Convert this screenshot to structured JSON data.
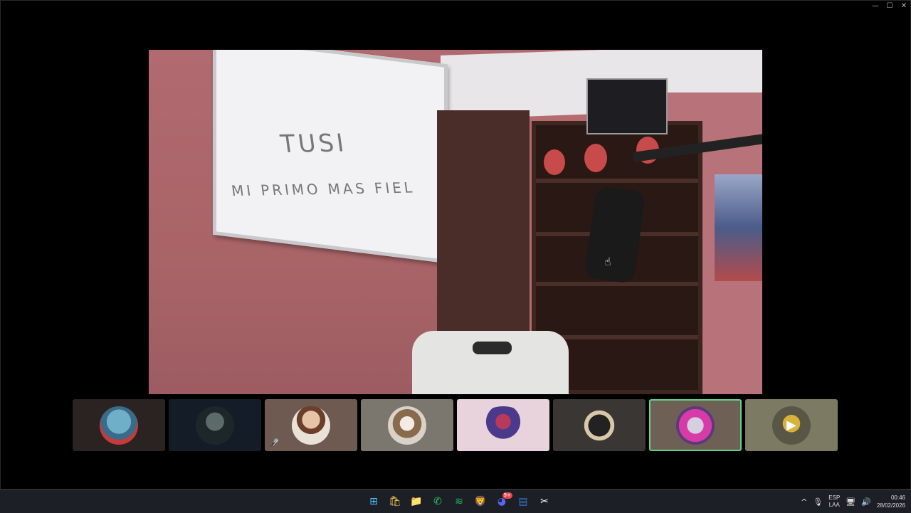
{
  "window": {
    "controls": [
      {
        "name": "minimize",
        "glyph": "—"
      },
      {
        "name": "maximize",
        "glyph": "☐"
      },
      {
        "name": "close",
        "glyph": "✕"
      }
    ]
  },
  "main_video": {
    "whiteboard_text": [
      "TUSI",
      "MI PRIMO MAS FIEL"
    ],
    "cursor": "hand-pointer"
  },
  "participants": [
    {
      "avatar": "anime-character-avatar",
      "bg": "#2b2322",
      "muted": false,
      "active": false
    },
    {
      "avatar": "dark-figure-avatar",
      "bg": "#141c27",
      "muted": false,
      "active": false
    },
    {
      "avatar": "illustrated-man-avatar",
      "bg": "#6e5a50",
      "muted": true,
      "mute_icon": "🎤̸",
      "active": false
    },
    {
      "avatar": "dog-avatar",
      "bg": "#7b776f",
      "muted": false,
      "active": false
    },
    {
      "avatar": "winged-person-avatar",
      "bg": "#e8d2dc",
      "muted": false,
      "active": false
    },
    {
      "avatar": "glowing-orb-avatar",
      "bg": "#3a3634",
      "muted": false,
      "active": false
    },
    {
      "avatar": "pink-collage-avatar",
      "bg": "#6e6055",
      "muted": false,
      "active": true
    },
    {
      "avatar": "camera-avatar",
      "bg": "#7d7a63",
      "muted": false,
      "active": false,
      "camera_glyph": "▶"
    }
  ],
  "taskbar": {
    "apps": [
      {
        "name": "windows-start",
        "glyph": "⊞",
        "color": "#4cc2ff"
      },
      {
        "name": "microsoft-store",
        "glyph": "🛍",
        "color": "#f2c14e"
      },
      {
        "name": "file-explorer",
        "glyph": "📁",
        "color": "#f5c242"
      },
      {
        "name": "whatsapp",
        "glyph": "✆",
        "color": "#25d366"
      },
      {
        "name": "spotify",
        "glyph": "≋",
        "color": "#1db954"
      },
      {
        "name": "brave",
        "glyph": "🦁",
        "color": "#fb542b"
      },
      {
        "name": "discord",
        "glyph": "◕",
        "color": "#5865f2",
        "badge": "9+"
      },
      {
        "name": "app-mail",
        "glyph": "▤",
        "color": "#2f78c4"
      },
      {
        "name": "app-snip",
        "glyph": "✂",
        "color": "#ffffff"
      }
    ],
    "tray": {
      "chevron": "^",
      "mic": "🎙",
      "lang_top": "ESP",
      "lang_bottom": "LAA",
      "network": "🖥",
      "volume": "🔊",
      "time": "00:46",
      "date": "28/02/2026"
    }
  }
}
